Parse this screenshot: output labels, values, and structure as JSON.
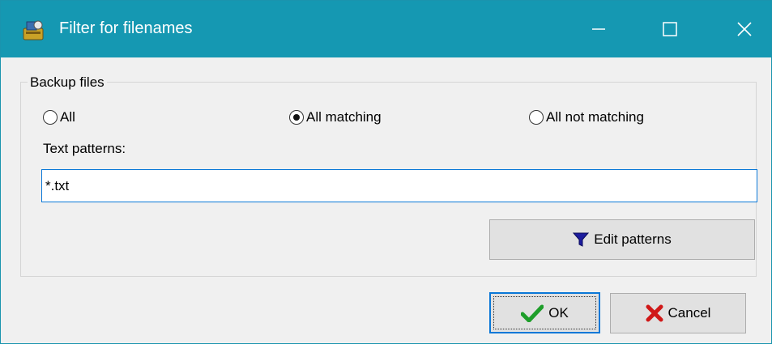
{
  "window": {
    "title": "Filter for filenames",
    "controls": [
      "minimize-icon",
      "maximize-icon",
      "close-icon"
    ],
    "title_bar_color": "#1598b2"
  },
  "group": {
    "legend": "Backup files",
    "options": [
      {
        "label": "All",
        "selected": false
      },
      {
        "label": "All matching",
        "selected": true
      },
      {
        "label": "All not matching",
        "selected": false
      }
    ],
    "patterns_label": "Text patterns:",
    "patterns_value": "*.txt",
    "edit_button": {
      "label": "Edit patterns",
      "icon": "funnel-icon"
    }
  },
  "footer": {
    "ok_button": {
      "label": "OK",
      "icon": "checkmark-icon"
    },
    "cancel_button": {
      "label": "Cancel",
      "icon": "x-icon"
    }
  }
}
